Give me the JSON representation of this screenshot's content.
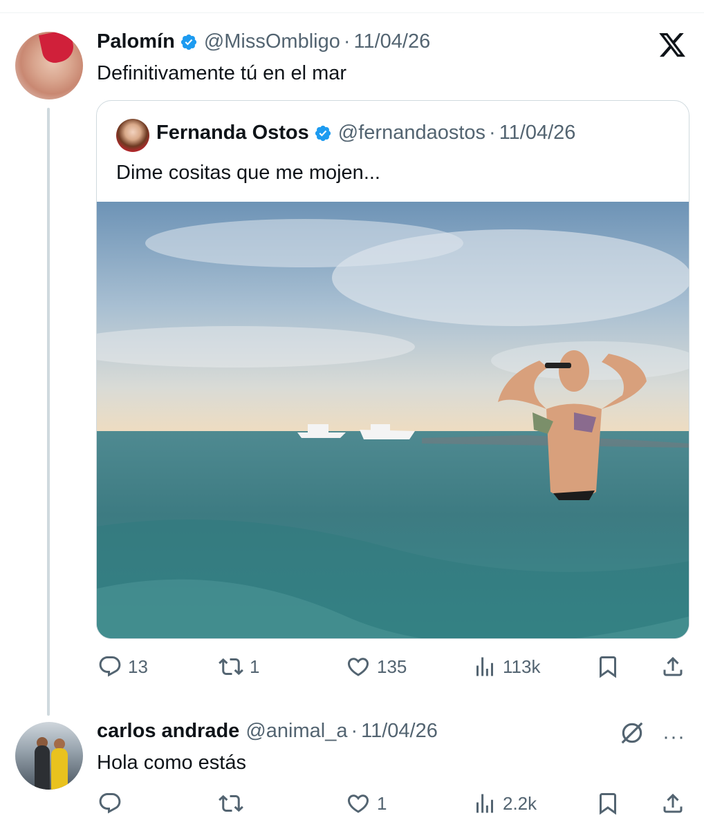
{
  "main_post": {
    "author_name": "Palomín",
    "handle": "@MissOmbligo",
    "separator": "·",
    "date": "11/04/26",
    "text": "Definitivamente tú en el mar"
  },
  "quoted_post": {
    "author_name": "Fernanda Ostos",
    "handle": "@fernandaostos",
    "separator": "·",
    "date": "11/04/26",
    "text": "Dime cositas que me mojen..."
  },
  "main_actions": {
    "replies": "13",
    "reposts": "1",
    "likes": "135",
    "views": "113k"
  },
  "reply_post": {
    "author_name": "carlos andrade",
    "handle": "@animal_a",
    "separator": "·",
    "date": "11/04/26",
    "text": "Hola como estás",
    "more": "···"
  },
  "reply_actions": {
    "replies": "",
    "reposts": "",
    "likes": "1",
    "views": "2.2k"
  },
  "icons": {
    "brand": "x-logo-icon",
    "verified": "verified-badge-icon",
    "reply": "reply-icon",
    "repost": "repost-icon",
    "like": "like-icon",
    "views": "views-icon",
    "bookmark": "bookmark-icon",
    "share": "share-icon",
    "grok": "grok-icon"
  },
  "colors": {
    "text_primary": "#0f1419",
    "text_secondary": "#536471",
    "verified_blue": "#1d9bf0",
    "border": "#cfd9de"
  }
}
